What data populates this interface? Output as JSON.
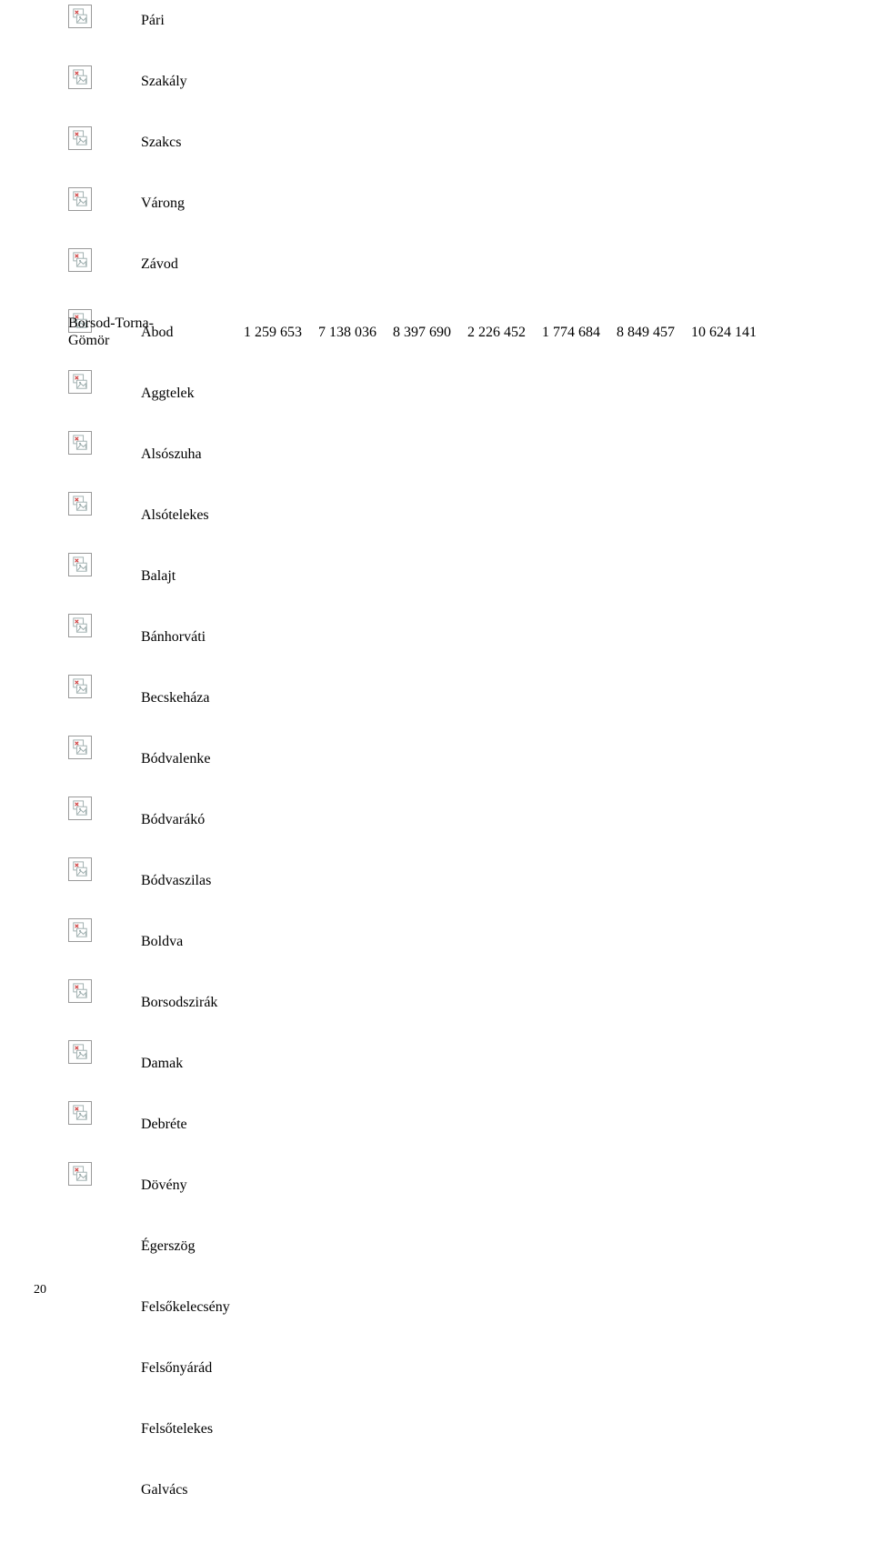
{
  "group_label_line1": "Borsod-Torna-",
  "group_label_line2": "Gömör",
  "intro_items": [
    "Pári",
    "Szakály",
    "Szakcs",
    "Várong",
    "Závod"
  ],
  "abod_row": {
    "name": "Abod",
    "values": [
      "1 259 653",
      "7 138 036",
      "8 397 690",
      "2 226 452",
      "1 774 684",
      "8 849 457",
      "10 624 141"
    ]
  },
  "tail_items": [
    "Aggtelek",
    "Alsószuha",
    "Alsótelekes",
    "Balajt",
    "Bánhorváti",
    "Becskeháza",
    "Bódvalenke",
    "Bódvarákó",
    "Bódvaszilas",
    "Boldva",
    "Borsodszirák",
    "Damak",
    "Debréte",
    "Dövény",
    "Égerszög",
    "Felsőkelecsény",
    "Felsőnyárád",
    "Felsőtelekes",
    "Galvács"
  ],
  "page_number": "20"
}
